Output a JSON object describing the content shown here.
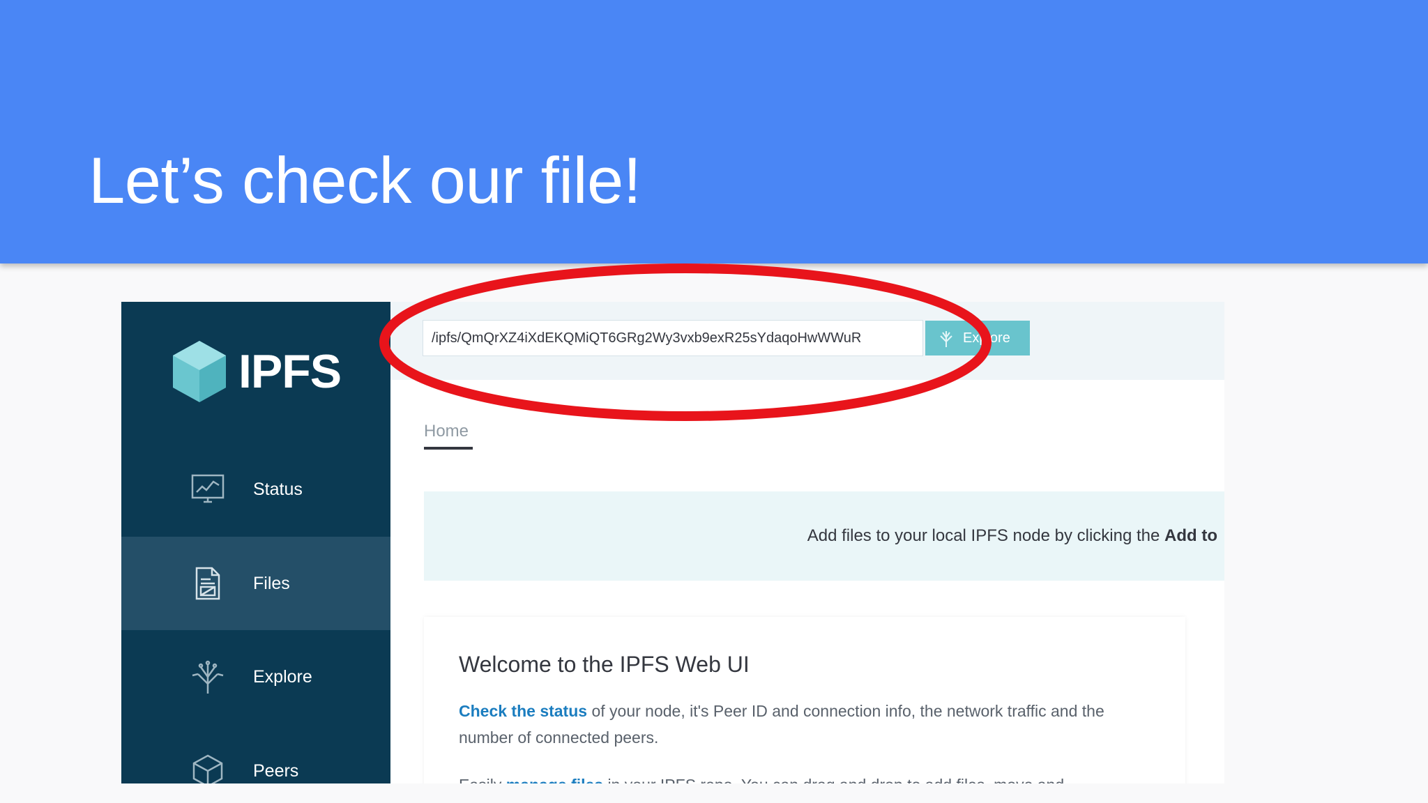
{
  "slide": {
    "title": "Let’s check our file!"
  },
  "sidebar": {
    "logo_text": "IPFS",
    "items": [
      {
        "label": "Status",
        "icon": "monitor-chart-icon",
        "active": false
      },
      {
        "label": "Files",
        "icon": "document-icon",
        "active": true
      },
      {
        "label": "Explore",
        "icon": "tree-icon",
        "active": false
      },
      {
        "label": "Peers",
        "icon": "cube-icon",
        "active": false
      }
    ]
  },
  "topbar": {
    "search_value": "/ipfs/QmQrXZ4iXdEKQMiQT6GRg2Wy3vxb9exR25sYdaqoHwWWuR",
    "explore_label": "Explore"
  },
  "main": {
    "breadcrumb": "Home",
    "banner": {
      "text": "Add files to your local IPFS node by clicking the ",
      "bold": "Add to"
    },
    "welcome": {
      "title": "Welcome to the IPFS Web UI",
      "p1_link": "Check the status",
      "p1_text": " of your node, it's Peer ID and connection info, the network traffic and the number of connected peers.",
      "p2_prefix": "Easily ",
      "p2_link": "manage files",
      "p2_text": " in your IPFS repo. You can drag and drop to add files, move and"
    }
  },
  "colors": {
    "header_bg": "#4a86f5",
    "sidebar_bg": "#0b3a53",
    "sidebar_active": "#244f68",
    "explore_btn": "#69c4cd",
    "annotation": "#e8141b"
  }
}
